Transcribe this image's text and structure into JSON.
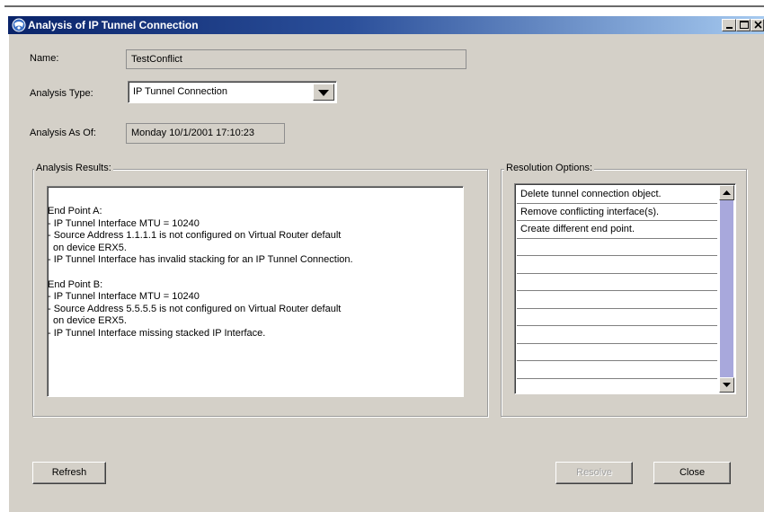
{
  "window": {
    "title": "Analysis of IP Tunnel Connection"
  },
  "form": {
    "name_label": "Name:",
    "name_value": "TestConflict",
    "analysis_type_label": "Analysis Type:",
    "analysis_type_value": "IP Tunnel Connection",
    "analysis_as_of_label": "Analysis As Of:",
    "analysis_as_of_value": "Monday 10/1/2001 17:10:23"
  },
  "analysis_results": {
    "title": "Analysis Results:",
    "lines": [
      "End Point A:",
      "- IP Tunnel Interface MTU = 10240",
      "- Source Address 1.1.1.1 is not configured on Virtual Router default",
      "  on device ERX5.",
      "- IP Tunnel Interface has invalid stacking for an IP Tunnel Connection.",
      "",
      "End Point B:",
      "- IP Tunnel Interface MTU = 10240",
      "- Source Address 5.5.5.5 is not configured on Virtual Router default",
      "  on device ERX5.",
      "- IP Tunnel Interface missing stacked IP Interface."
    ]
  },
  "resolution_options": {
    "title": "Resolution Options:",
    "items": [
      "Delete tunnel connection object.",
      "Remove conflicting interface(s).",
      "Create different end point.",
      "",
      "",
      "",
      "",
      "",
      "",
      "",
      ""
    ]
  },
  "buttons": {
    "refresh": "Refresh",
    "resolve": "Resolve",
    "close": "Close"
  },
  "icons": {
    "app": "network-globe-icon",
    "minimize": "minimize-icon",
    "maximize": "maximize-icon",
    "close": "close-icon",
    "dropdown": "chevron-down-icon",
    "scroll_up": "scroll-up-arrow-icon",
    "scroll_down": "scroll-down-arrow-icon"
  },
  "colors": {
    "title_bar_start": "#0a246a",
    "title_bar_end": "#a6caf0",
    "window_bg": "#d4d0c8",
    "scroll_thumb": "#b4b4e4"
  }
}
